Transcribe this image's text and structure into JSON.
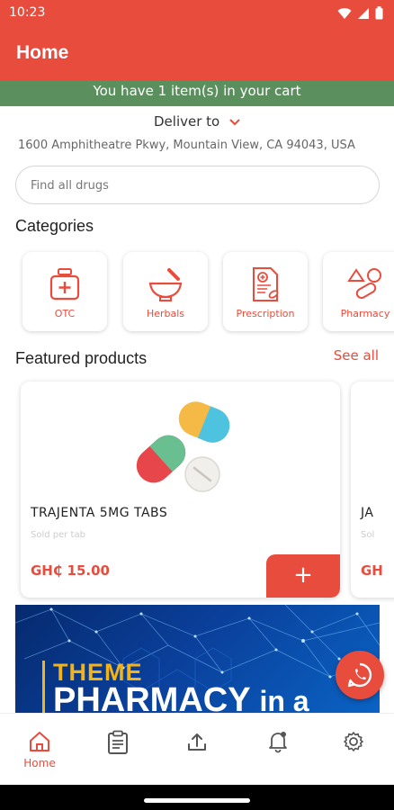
{
  "status_bar": {
    "time": "10:23"
  },
  "app_bar": {
    "title": "Home"
  },
  "cart_banner": {
    "text": "You have 1 item(s) in your cart"
  },
  "delivery": {
    "label": "Deliver to",
    "address": "1600 Amphitheatre Pkwy, Mountain View, CA 94043, USA"
  },
  "search": {
    "placeholder": "Find all drugs",
    "value": ""
  },
  "categories": {
    "title": "Categories",
    "items": [
      {
        "label": "OTC",
        "icon": "first-aid-bottle-icon"
      },
      {
        "label": "Herbals",
        "icon": "mortar-pestle-icon"
      },
      {
        "label": "Prescription",
        "icon": "prescription-document-icon"
      },
      {
        "label": "Pharmacy",
        "icon": "pills-icon"
      }
    ]
  },
  "featured": {
    "title": "Featured products",
    "see_all": "See all",
    "products": [
      {
        "name": "TRAJENTA 5MG TABS",
        "unit": "Sold per tab",
        "price": "GH₵ 15.00",
        "add_label": "+"
      },
      {
        "name": "JA",
        "unit": "Sol",
        "price": "GH"
      }
    ]
  },
  "promo_banner": {
    "theme": "THEME",
    "headline": "PHARMACY",
    "headline_tail": "in a"
  },
  "bottom_nav": {
    "items": [
      {
        "label": "Home",
        "icon": "home-icon",
        "active": true
      },
      {
        "label": "",
        "icon": "clipboard-icon"
      },
      {
        "label": "",
        "icon": "upload-icon"
      },
      {
        "label": "",
        "icon": "bell-icon"
      },
      {
        "label": "",
        "icon": "settings-icon"
      }
    ]
  },
  "colors": {
    "primary": "#e84c3d",
    "banner_green": "#5b8f5e",
    "accent_yellow": "#f2b418"
  }
}
